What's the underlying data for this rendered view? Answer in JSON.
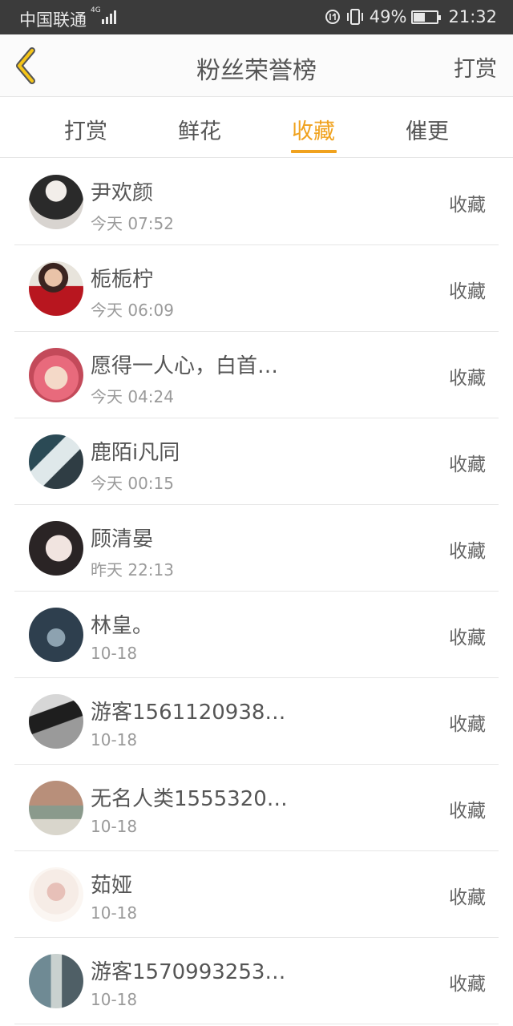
{
  "status_bar": {
    "carrier": "中国联通",
    "network": "4G",
    "battery_text": "49%",
    "battery_level": 0.49,
    "time": "21:32"
  },
  "header": {
    "title": "粉丝荣誉榜",
    "action_label": "打赏"
  },
  "tabs": [
    {
      "label": "打赏",
      "active": false
    },
    {
      "label": "鲜花",
      "active": false
    },
    {
      "label": "收藏",
      "active": true
    },
    {
      "label": "催更",
      "active": false
    }
  ],
  "colors": {
    "accent": "#f0a21e",
    "status_bar_bg": "#3b3b3b",
    "text": "#555555",
    "subtext": "#9a9a9a"
  },
  "fans": [
    {
      "name": "尹欢颜",
      "time": "今天 07:52",
      "action": "收藏"
    },
    {
      "name": "栀栀柠",
      "time": "今天 06:09",
      "action": "收藏"
    },
    {
      "name": "愿得一人心，白首…",
      "time": "今天 04:24",
      "action": "收藏"
    },
    {
      "name": "鹿陌i凡同",
      "time": "今天 00:15",
      "action": "收藏"
    },
    {
      "name": "顾清晏",
      "time": "昨天 22:13",
      "action": "收藏"
    },
    {
      "name": "林皇。",
      "time": "10-18",
      "action": "收藏"
    },
    {
      "name": "游客1561120938…",
      "time": "10-18",
      "action": "收藏"
    },
    {
      "name": "无名人类1555320…",
      "time": "10-18",
      "action": "收藏"
    },
    {
      "name": "茹娅",
      "time": "10-18",
      "action": "收藏"
    },
    {
      "name": "游客1570993253…",
      "time": "10-18",
      "action": "收藏"
    }
  ]
}
